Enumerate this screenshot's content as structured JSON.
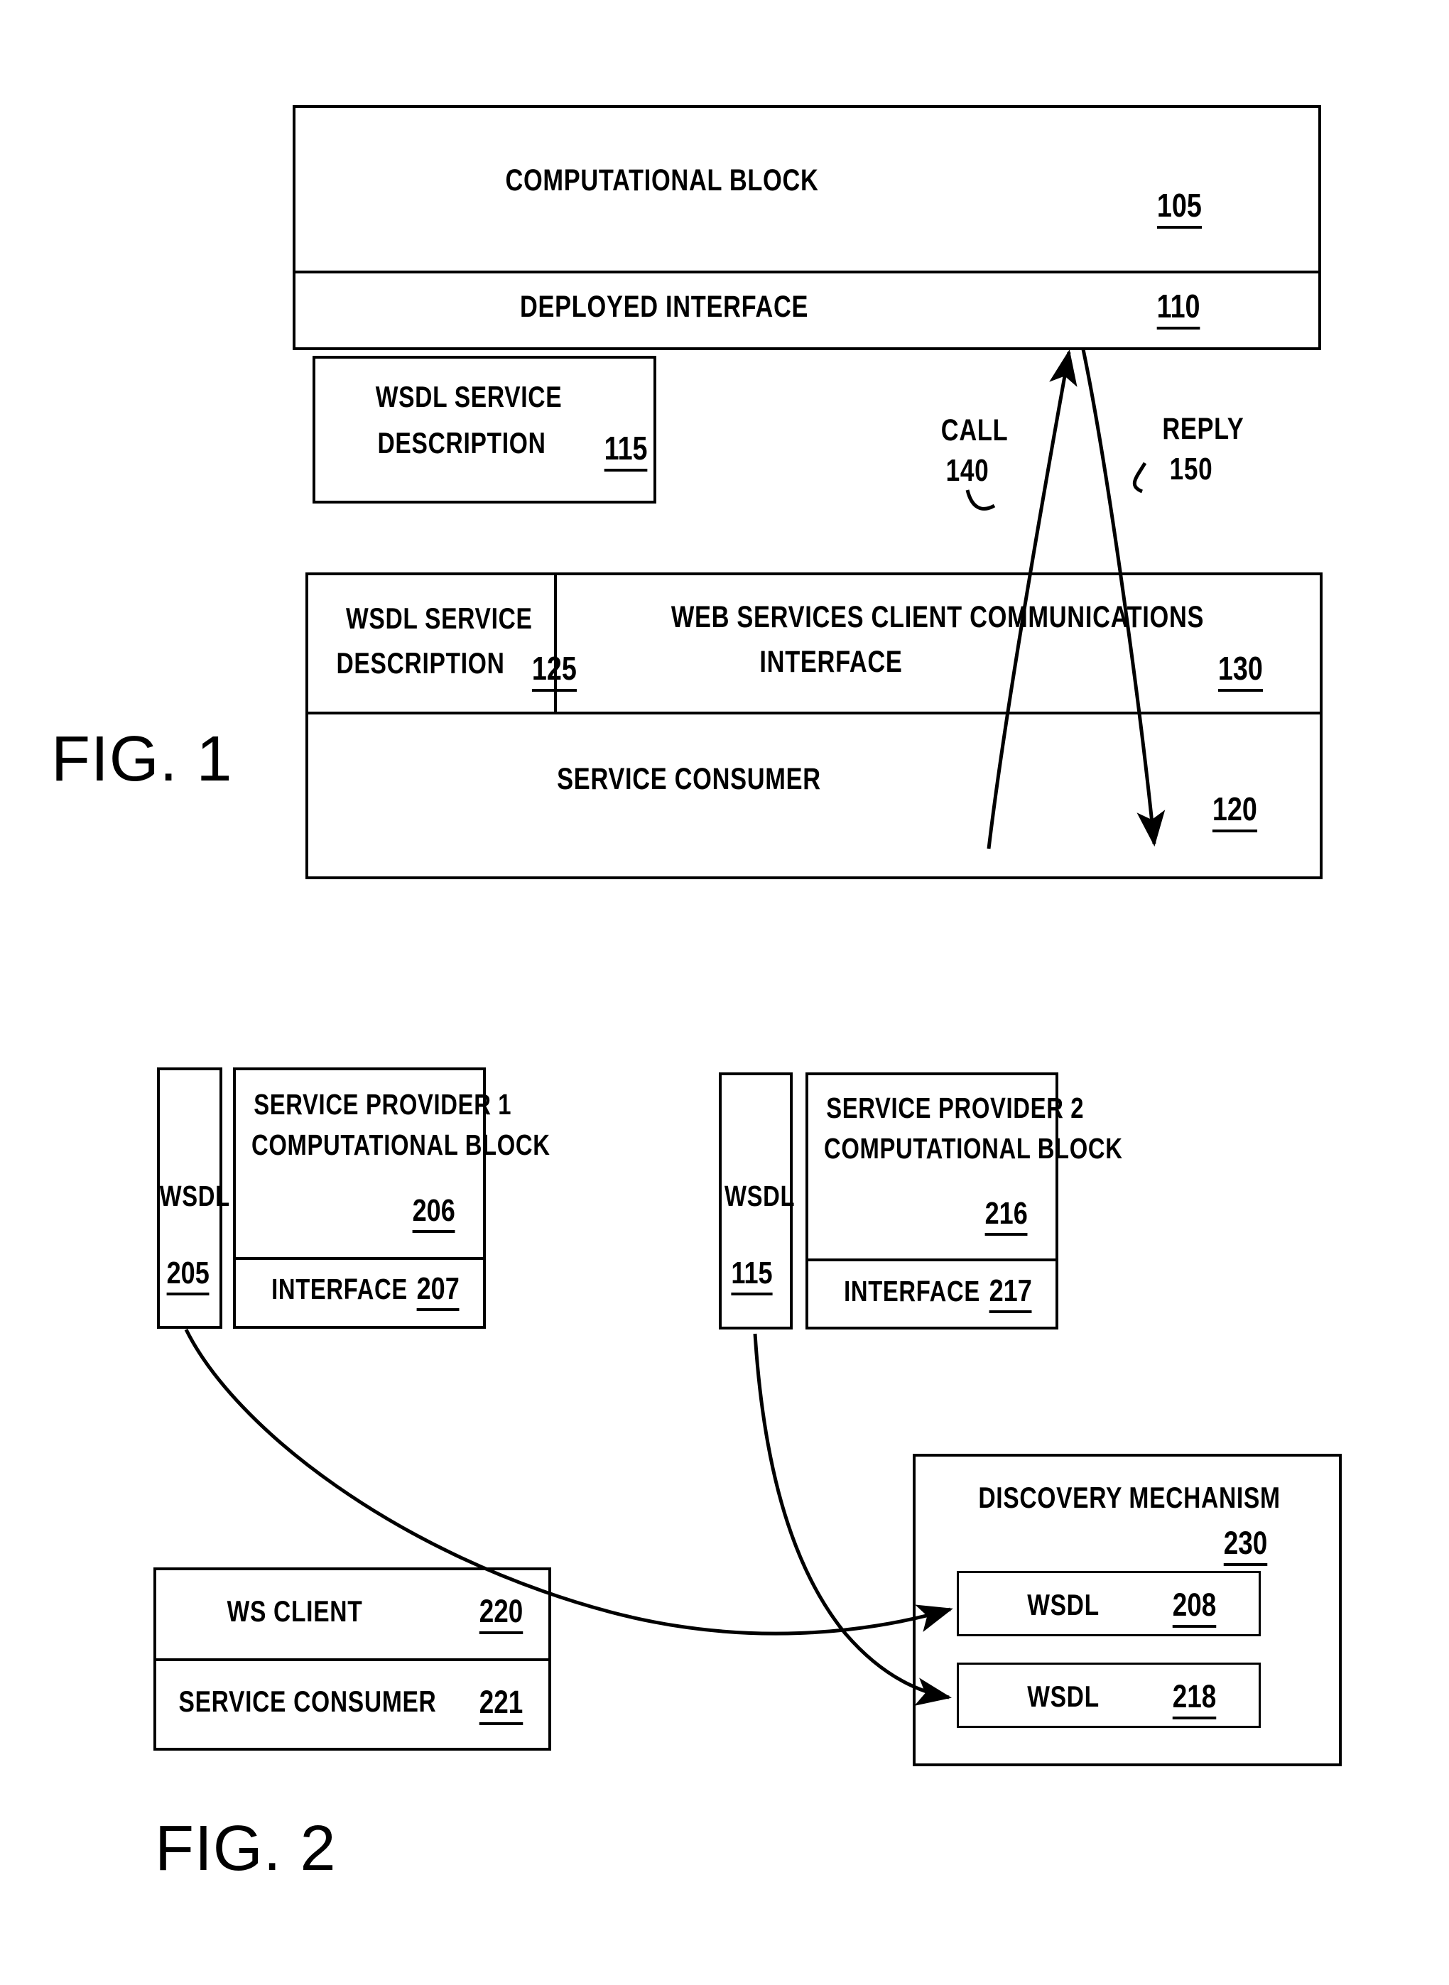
{
  "document": {
    "type": "patent-drawing-sheet",
    "figures": [
      "FIG. 1",
      "FIG. 2"
    ]
  },
  "fig1": {
    "caption": "FIG. 1",
    "provider": {
      "computational_block": {
        "label": "COMPUTATIONAL BLOCK",
        "ref": "105"
      },
      "deployed_interface": {
        "label": "DEPLOYED INTERFACE",
        "ref": "110"
      }
    },
    "wsdl_provider": {
      "line1": "WSDL SERVICE",
      "line2": "DESCRIPTION",
      "ref": "115"
    },
    "arrows": {
      "call": {
        "label": "CALL",
        "ref": "140"
      },
      "reply": {
        "label": "REPLY",
        "ref": "150"
      }
    },
    "consumer": {
      "wsdl": {
        "line1": "WSDL SERVICE",
        "line2": "DESCRIPTION",
        "ref": "125"
      },
      "client_interface": {
        "line1": "WEB SERVICES CLIENT COMMUNICATIONS",
        "line2": "INTERFACE",
        "ref": "130"
      },
      "service_consumer": {
        "label": "SERVICE CONSUMER",
        "ref": "120"
      }
    }
  },
  "fig2": {
    "caption": "FIG. 2",
    "provider1": {
      "wsdl": {
        "label": "WSDL",
        "ref": "205"
      },
      "block": {
        "line1": "SERVICE PROVIDER 1",
        "line2": "COMPUTATIONAL BLOCK",
        "ref": "206"
      },
      "interface": {
        "label": "INTERFACE",
        "ref": "207"
      }
    },
    "provider2": {
      "wsdl": {
        "label": "WSDL",
        "ref": "115"
      },
      "block": {
        "line1": "SERVICE PROVIDER 2",
        "line2": "COMPUTATIONAL BLOCK",
        "ref": "216"
      },
      "interface": {
        "label": "INTERFACE",
        "ref": "217"
      }
    },
    "client": {
      "ws_client": {
        "label": "WS CLIENT",
        "ref": "220"
      },
      "service_consumer": {
        "label": "SERVICE CONSUMER",
        "ref": "221"
      }
    },
    "discovery": {
      "title": "DISCOVERY MECHANISM",
      "ref": "230",
      "entries": [
        {
          "label": "WSDL",
          "ref": "208"
        },
        {
          "label": "WSDL",
          "ref": "218"
        }
      ]
    }
  },
  "colors": {
    "ink": "#000000",
    "paper": "#ffffff"
  }
}
